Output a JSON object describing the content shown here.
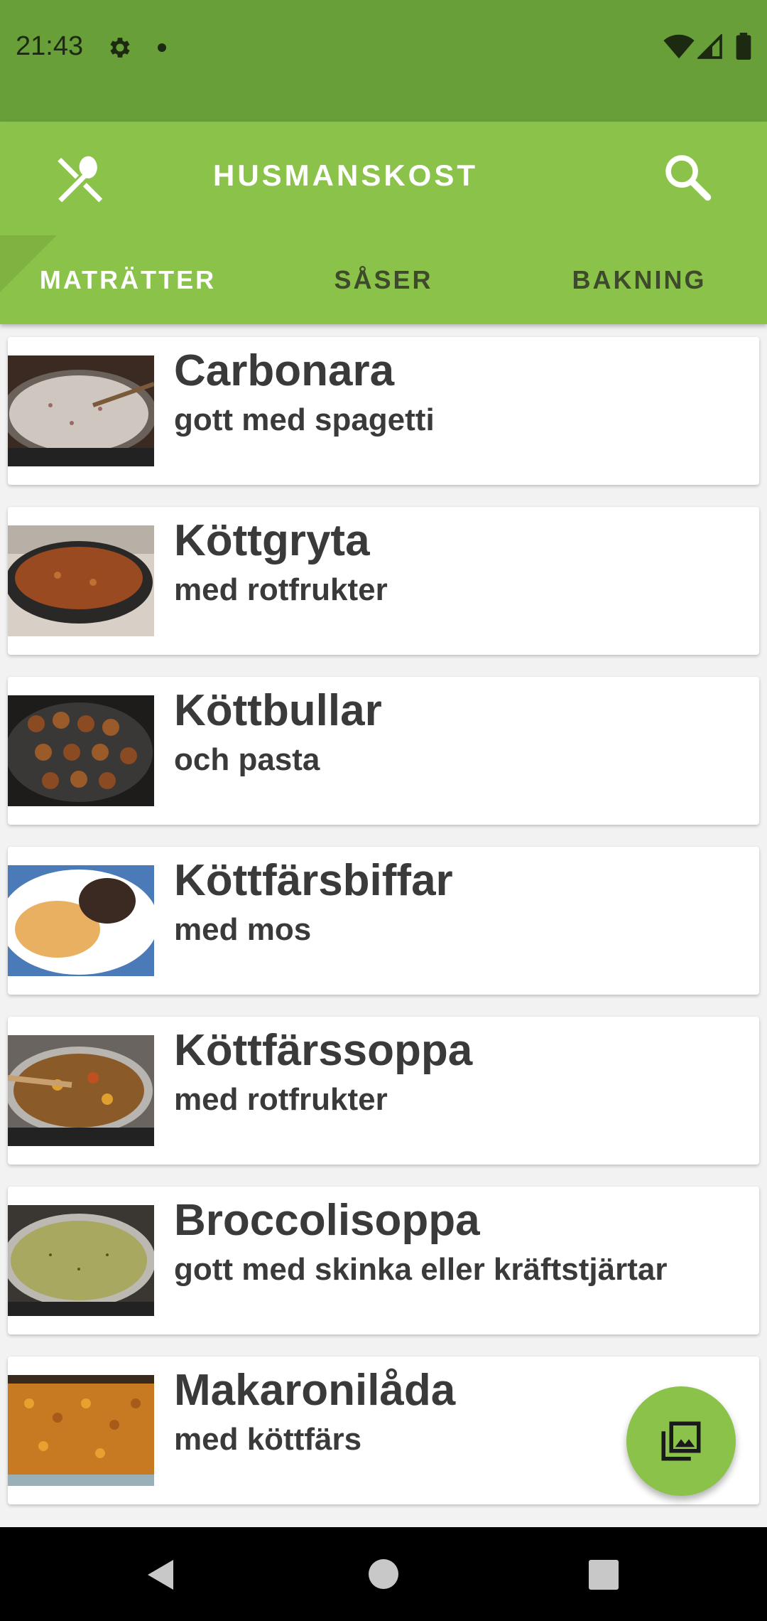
{
  "status_bar": {
    "time": "21:43",
    "icons": [
      "gear-icon",
      "notification-dot",
      "wifi-icon",
      "signal-icon",
      "battery-icon"
    ],
    "background": "#689f38"
  },
  "app_bar": {
    "title": "HUSMANSKOST",
    "logo_icon": "fork-spoon-icon",
    "search_icon": "search-icon",
    "background": "#8bc34a"
  },
  "tabs": [
    {
      "label": "MATRÄTTER",
      "active": true
    },
    {
      "label": "SÅSER",
      "active": false
    },
    {
      "label": "BAKNING",
      "active": false
    }
  ],
  "recipes": [
    {
      "title": "Carbonara",
      "subtitle": "gott med spagetti"
    },
    {
      "title": "Köttgryta",
      "subtitle": "med rotfrukter"
    },
    {
      "title": "Köttbullar",
      "subtitle": "och pasta"
    },
    {
      "title": "Köttfärsbiffar",
      "subtitle": "med mos"
    },
    {
      "title": "Köttfärssoppa",
      "subtitle": "med rotfrukter"
    },
    {
      "title": "Broccolisoppa",
      "subtitle": "gott med skinka eller kräftstjärtar"
    },
    {
      "title": "Makaronilåda",
      "subtitle": "med köttfärs"
    }
  ],
  "fab": {
    "icon": "photo-library-icon"
  },
  "nav_bar": {
    "icons": [
      "back-icon",
      "home-icon",
      "recents-icon"
    ]
  },
  "colors": {
    "accent": "#8bc34a",
    "status": "#689f38",
    "text": "#3a3a3a"
  }
}
